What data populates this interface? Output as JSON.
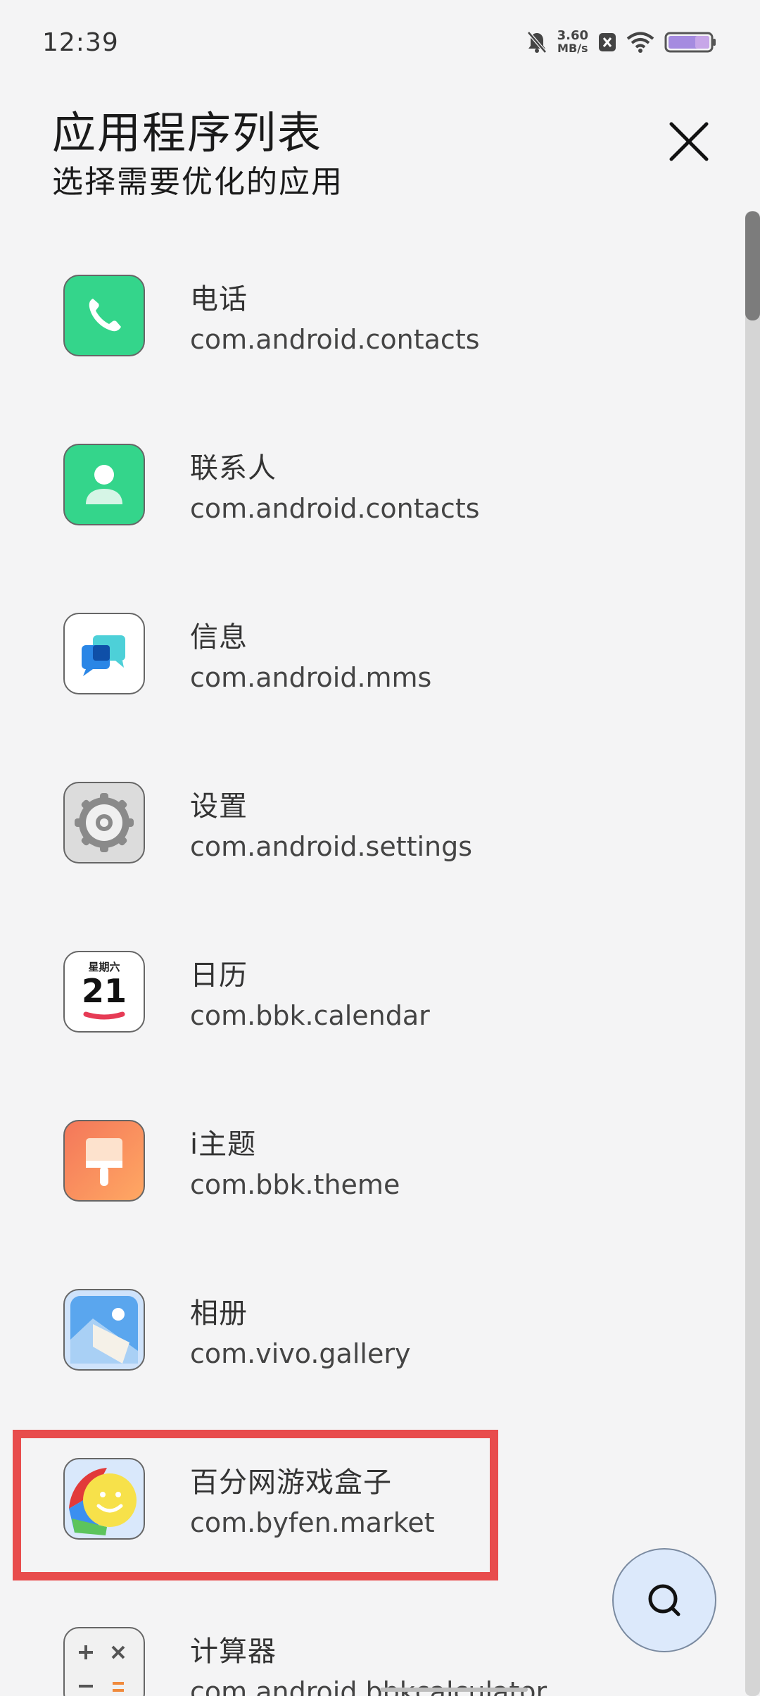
{
  "status_bar": {
    "time": "12:39",
    "net_speed": "3.60",
    "net_unit": "MB/s",
    "icons": [
      "mute-bell-icon",
      "close-box-icon",
      "wifi-icon",
      "battery-icon"
    ]
  },
  "header": {
    "title": "应用程序列表",
    "subtitle": "选择需要优化的应用",
    "close_icon": "close-icon"
  },
  "apps": [
    {
      "name": "电话",
      "package": "com.android.contacts",
      "icon": "phone-icon"
    },
    {
      "name": "联系人",
      "package": "com.android.contacts",
      "icon": "contacts-icon"
    },
    {
      "name": "信息",
      "package": "com.android.mms",
      "icon": "messages-icon"
    },
    {
      "name": "设置",
      "package": "com.android.settings",
      "icon": "settings-gear-icon"
    },
    {
      "name": "日历",
      "package": "com.bbk.calendar",
      "icon": "calendar-icon",
      "calendar_weekday": "星期六",
      "calendar_day": "21"
    },
    {
      "name": "i主题",
      "package": "com.bbk.theme",
      "icon": "theme-brush-icon"
    },
    {
      "name": "相册",
      "package": "com.vivo.gallery",
      "icon": "gallery-icon"
    },
    {
      "name": "百分网游戏盒子",
      "package": "com.byfen.market",
      "icon": "byfen-smiley-icon",
      "highlighted": true
    },
    {
      "name": "计算器",
      "package": "com.android.bbkcalculator",
      "icon": "calculator-icon"
    }
  ],
  "fab": {
    "icon": "search-icon"
  },
  "colors": {
    "background": "#f4f4f5",
    "highlight": "#e84c4c",
    "fab_bg": "#dce9fb",
    "phone_green": "#34d58b"
  }
}
